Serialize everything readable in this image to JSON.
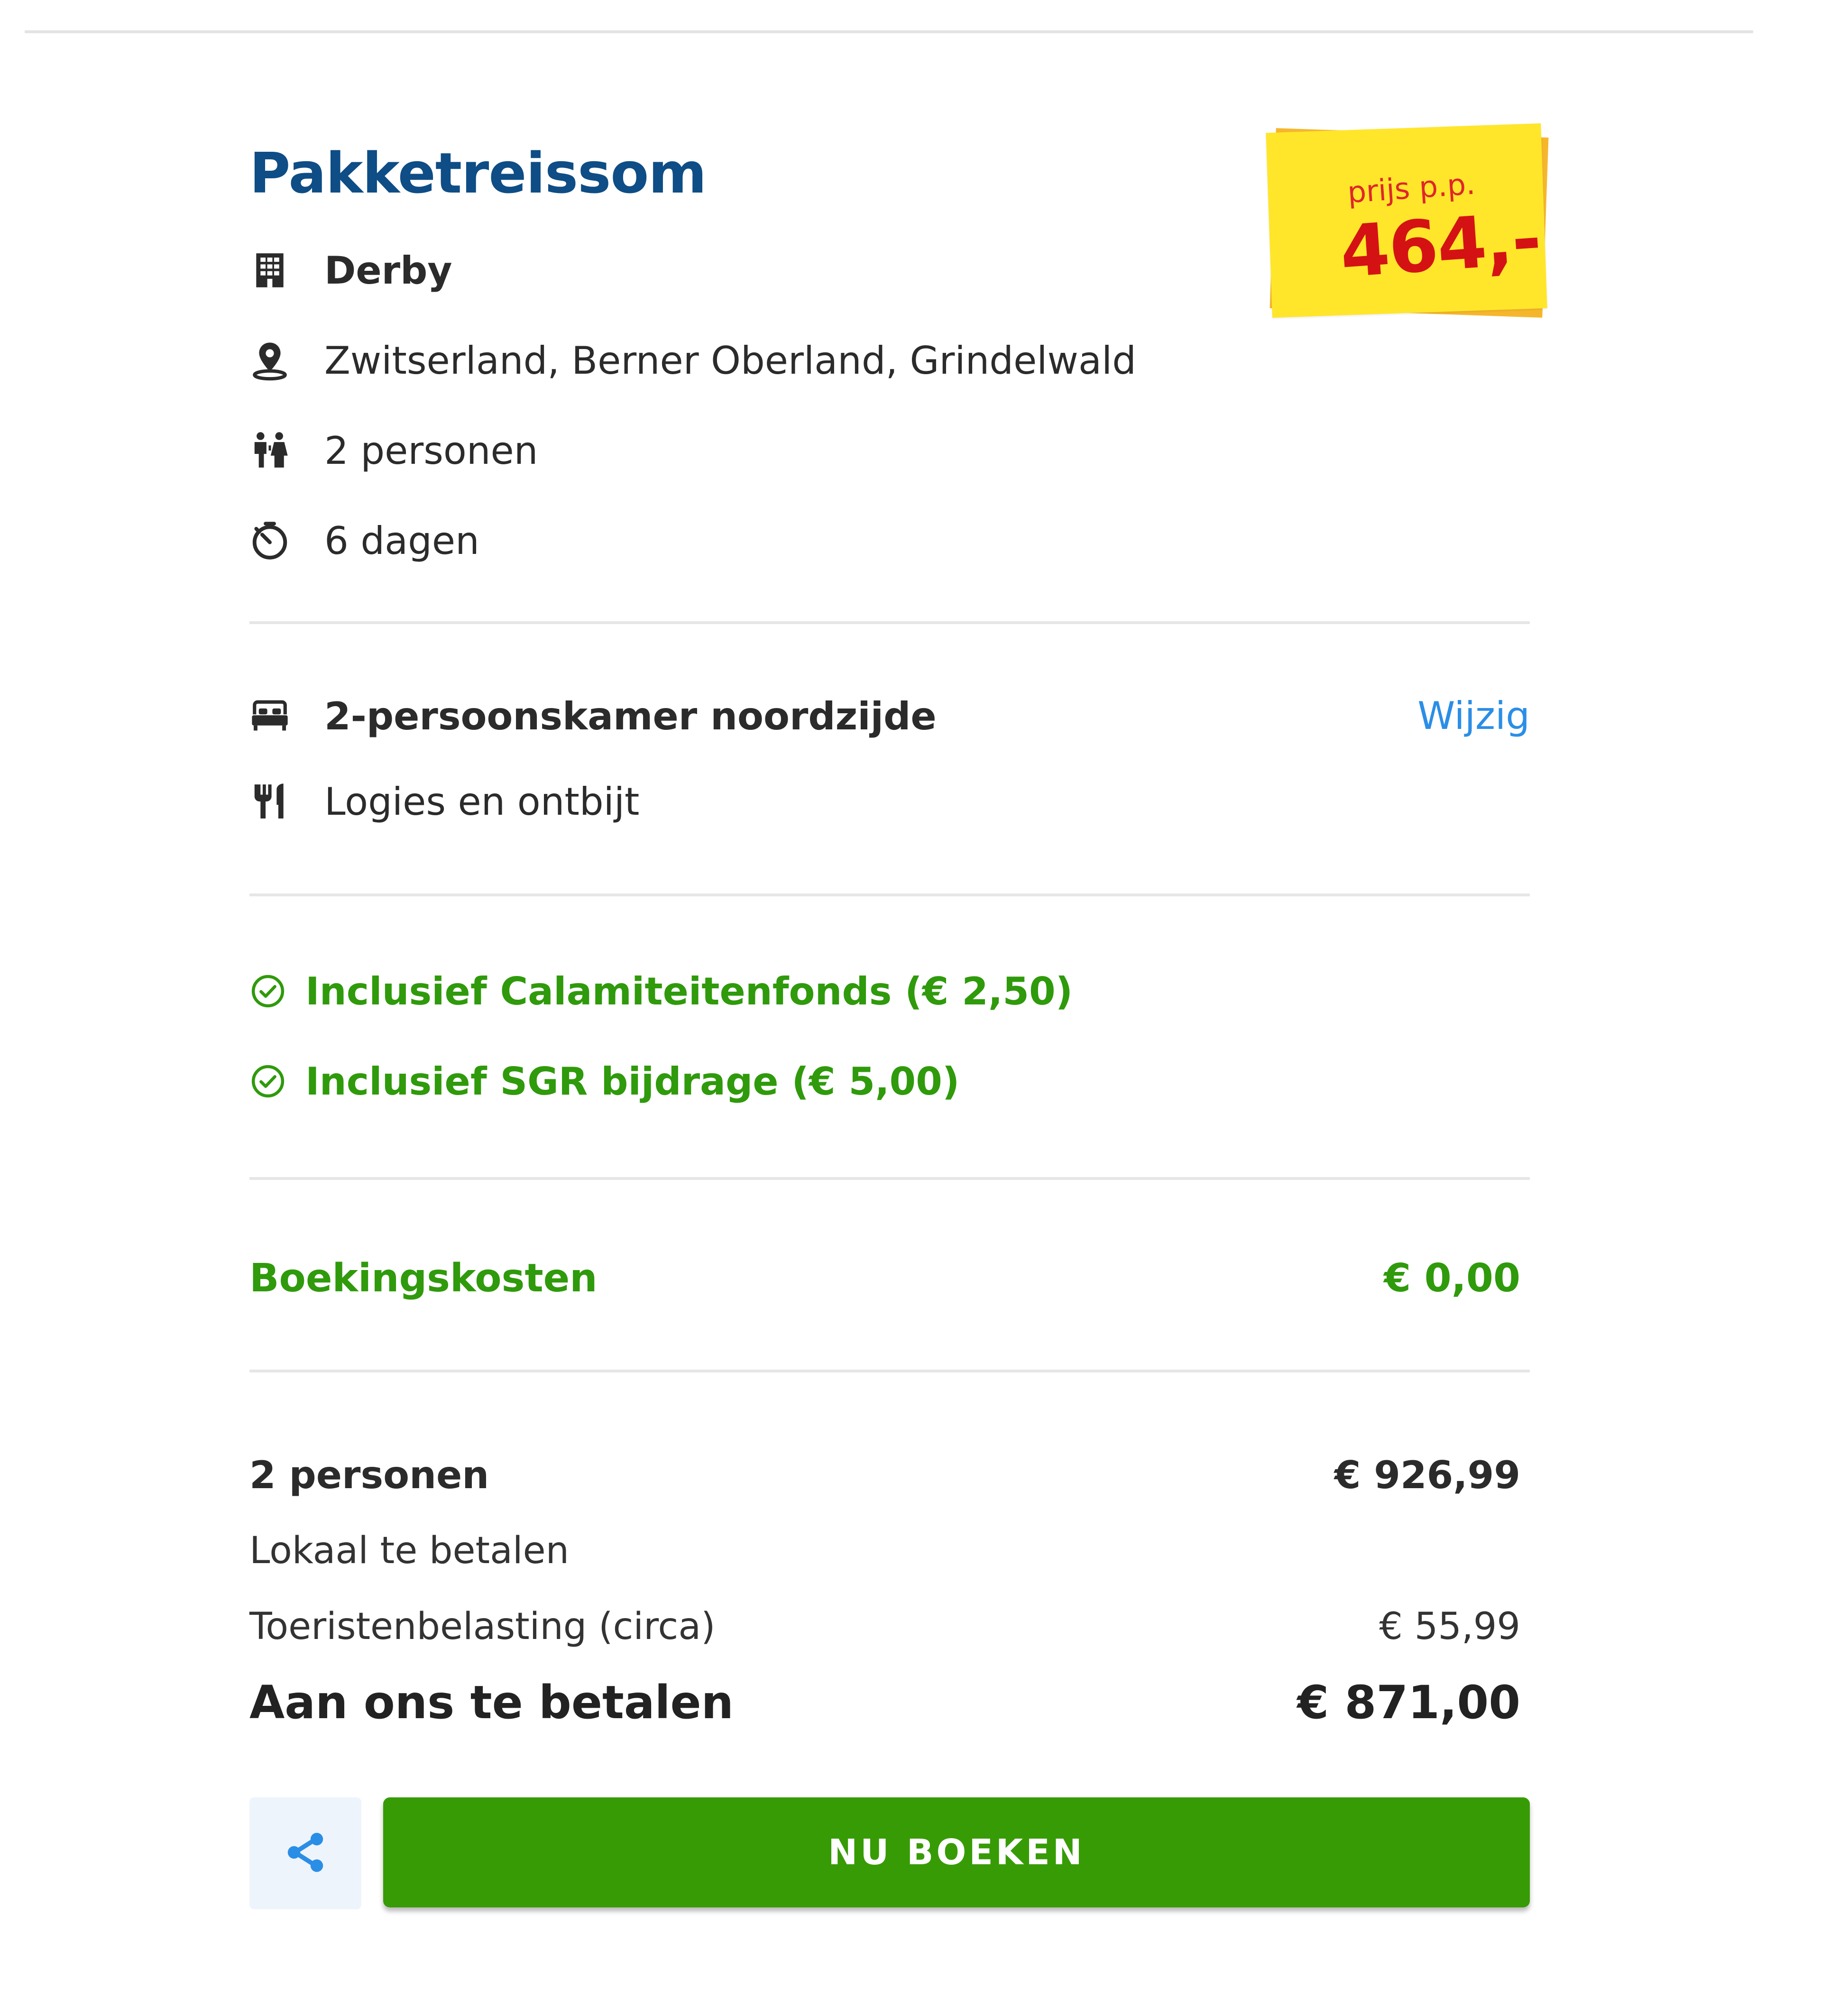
{
  "summary": {
    "title": "Pakketreissom",
    "price_tag": {
      "label": "prijs p.p.",
      "value": "464,-"
    },
    "details": {
      "hotel": "Derby",
      "location": "Zwitserland, Berner Oberland, Grindelwald",
      "persons": "2 personen",
      "duration": "6 dagen"
    },
    "room": {
      "name": "2-persoonskamer noordzijde",
      "change_link": "Wijzig",
      "board": "Logies en ontbijt"
    },
    "inclusions": [
      "Inclusief Calamiteitenfonds (€ 2,50)",
      "Inclusief SGR bijdrage (€ 5,00)"
    ],
    "booking_fee": {
      "label": "Boekingskosten",
      "value": "€ 0,00"
    },
    "totals": {
      "persons_label": "2 personen",
      "persons_value": "€ 926,99",
      "local_label": "Lokaal te betalen",
      "tax_label": "Toeristenbelasting (circa)",
      "tax_value": "€ 55,99",
      "total_label": "Aan ons te betalen",
      "total_value": "€ 871,00"
    },
    "actions": {
      "book_label": "NU BOEKEN"
    }
  },
  "colors": {
    "title": "#0e4d85",
    "link": "#2b8ee6",
    "green": "#2f9a0b",
    "button": "#379b05",
    "price_tag_yellow": "#ffe62a",
    "price_tag_orange": "#f6b62c",
    "price_red": "#d41214"
  },
  "icons": {
    "hotel": "building-icon",
    "location": "map-pin-icon",
    "persons": "people-icon",
    "duration": "stopwatch-icon",
    "room": "bed-icon",
    "board": "fork-knife-icon",
    "inclusion": "check-circle-icon",
    "share": "share-icon"
  }
}
